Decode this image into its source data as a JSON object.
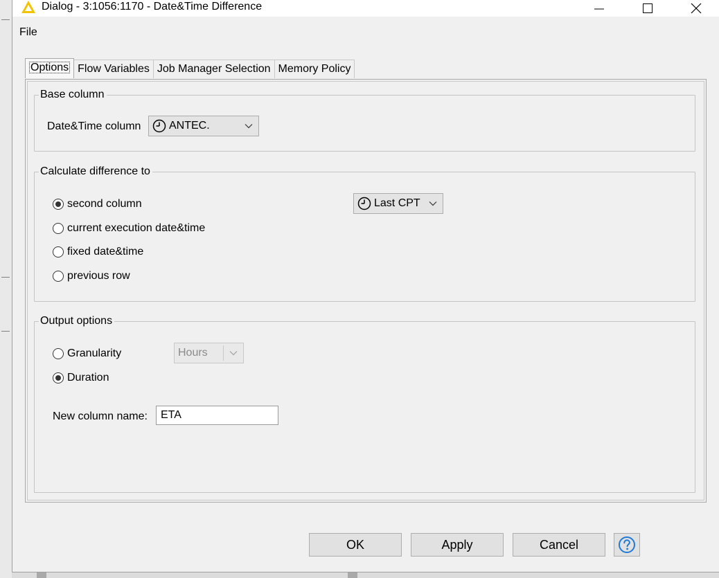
{
  "window": {
    "title": "Dialog - 3:1056:1170 - Date&Time Difference",
    "controls": {
      "minimize_icon": "minimize-icon",
      "maximize_icon": "maximize-icon",
      "close_icon": "close-icon"
    }
  },
  "menu": {
    "file": "File"
  },
  "tabs": [
    {
      "label": "Options",
      "active": true
    },
    {
      "label": "Flow Variables",
      "active": false
    },
    {
      "label": "Job Manager Selection",
      "active": false
    },
    {
      "label": "Memory Policy",
      "active": false
    }
  ],
  "base_column": {
    "legend": "Base column",
    "field_label": "Date&Time column",
    "selected": "ANTEC."
  },
  "calc_diff": {
    "legend": "Calculate difference to",
    "options": [
      {
        "label": "second column",
        "checked": true
      },
      {
        "label": "current execution date&time",
        "checked": false
      },
      {
        "label": "fixed date&time",
        "checked": false
      },
      {
        "label": "previous row",
        "checked": false
      }
    ],
    "second_column_selected": "Last CPT"
  },
  "output": {
    "legend": "Output options",
    "granularity_label": "Granularity",
    "granularity_checked": false,
    "granularity_value": "Hours",
    "duration_label": "Duration",
    "duration_checked": true,
    "new_col_label": "New column name:",
    "new_col_value": "ETA"
  },
  "buttons": {
    "ok": "OK",
    "apply": "Apply",
    "cancel": "Cancel",
    "help_icon": "help-icon"
  },
  "colors": {
    "help_blue": "#1f7ad6",
    "title_icon_yellow": "#f2c300"
  }
}
